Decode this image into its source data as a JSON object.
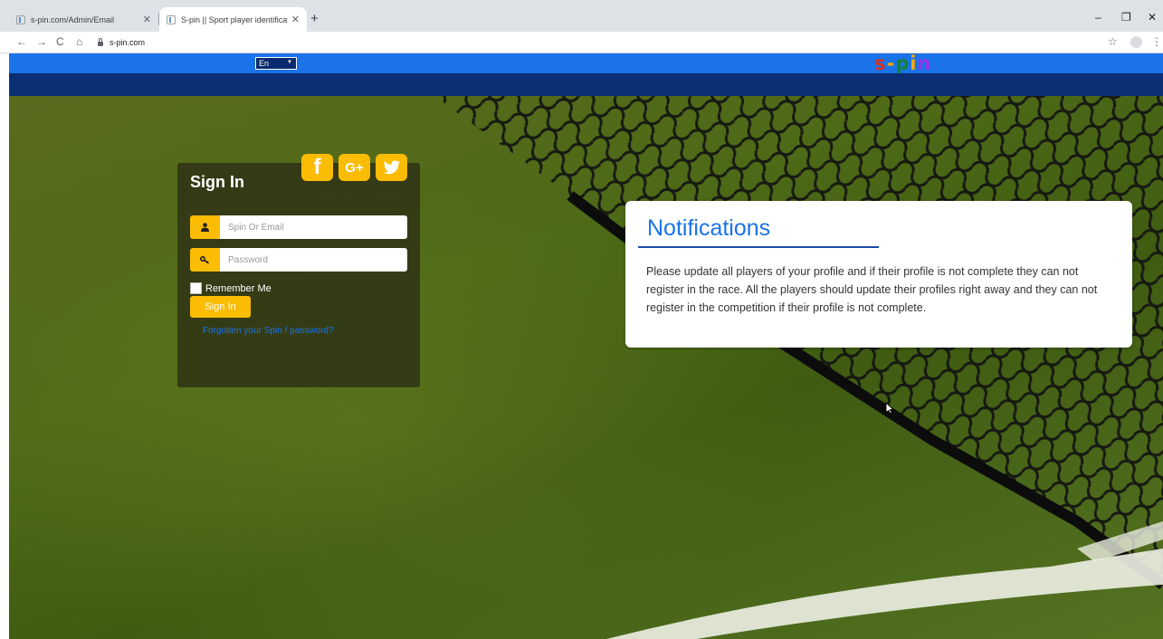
{
  "browser": {
    "tabs": [
      {
        "title": "s-pin.com/Admin/Email",
        "active": false
      },
      {
        "title": "S-pin || Sport player identificatio",
        "active": true
      }
    ],
    "new_tab_label": "+",
    "window_controls": {
      "minimize": "–",
      "restore": "❐",
      "close": "✕"
    },
    "nav": {
      "back": "←",
      "forward": "→",
      "reload": "C",
      "home": "⌂"
    },
    "url": "s-pin.com",
    "bookmark_icon": "☆",
    "menu_icon": "⋮"
  },
  "header": {
    "language": "En",
    "logo": {
      "s": "s",
      "dash": "-",
      "p": "p",
      "i": "i",
      "n": "n"
    }
  },
  "signin": {
    "title": "Sign In",
    "social": {
      "facebook": "f",
      "google": "G+",
      "twitter": "🐦"
    },
    "username_placeholder": "Spin Or Email",
    "password_placeholder": "Password",
    "remember_label": "Remember Me",
    "submit_label": "Sign In",
    "forgot_link": "Forgotten your Spin / password?"
  },
  "notifications": {
    "title": "Notifications",
    "message": "Please update all players of your profile and if their profile is not complete they can not register in the race. All the players should update their profiles right away and they can not register in the competition if their profile is not complete."
  },
  "colors": {
    "site_top_bar": "#1a73e8",
    "site_nav_bar": "#0b2e74",
    "accent_yellow": "#fbbc04",
    "notification_title": "#1a73e8"
  }
}
